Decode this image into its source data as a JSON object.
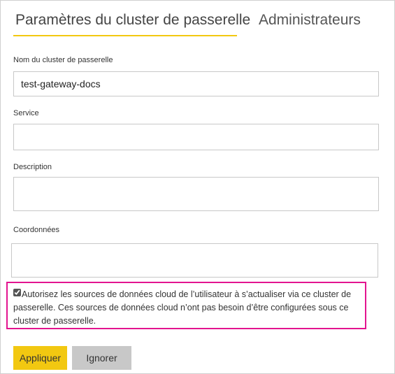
{
  "tabs": {
    "general": "Paramètres du cluster de passerelle",
    "admins": "Administrateurs"
  },
  "fields": {
    "cluster_name": {
      "label": "Nom du cluster de passerelle",
      "value": "test-gateway-docs"
    },
    "service": {
      "label": "Service",
      "value": ""
    },
    "description": {
      "label": "Description",
      "value": ""
    },
    "contact": {
      "label": "Coordonnées",
      "value": ""
    }
  },
  "consent": {
    "checked": true,
    "text": "Autorisez les sources de données cloud de l’utilisateur à s’actualiser via ce cluster de passerelle. Ces sources de données cloud n’ont pas besoin d’être configurées sous ce cluster de passerelle."
  },
  "buttons": {
    "apply": "Appliquer",
    "ignore": "Ignorer"
  },
  "colors": {
    "accent": "#f2c811",
    "highlight": "#e3148f",
    "secondary_button": "#c8c8c8"
  }
}
